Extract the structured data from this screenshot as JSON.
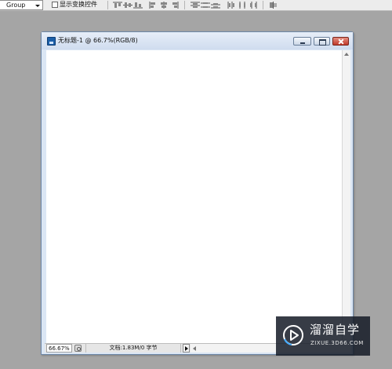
{
  "options_bar": {
    "group_select_value": "Group",
    "show_transform_controls_label": "显示变换控件",
    "show_transform_controls_checked": false,
    "align_buttons": [
      "align-top-icon",
      "align-vcenter-icon",
      "align-bottom-icon",
      "align-left-icon",
      "align-hcenter-icon",
      "align-right-icon"
    ],
    "distribute_buttons": [
      "distribute-top-icon",
      "distribute-vcenter-icon",
      "distribute-bottom-icon",
      "distribute-left-icon",
      "distribute-hcenter-icon",
      "distribute-right-icon"
    ],
    "auto_align_icon": "auto-align-layers-icon"
  },
  "document": {
    "title": "无标题-1 @ 66.7%(RGB/8)",
    "canvas_color": "#ffffff",
    "status": {
      "zoom": "66.67%",
      "doc_info": "文档:1.83M/0 字节"
    }
  },
  "watermark": {
    "brand": "溜溜自学",
    "url": "ZIXUE.3D66.COM"
  },
  "colors": {
    "workspace_bg": "#a5a5a5",
    "close_button": "#c0392b",
    "watermark_bg": "#161c28",
    "logo_accent": "#3fa9ff"
  }
}
